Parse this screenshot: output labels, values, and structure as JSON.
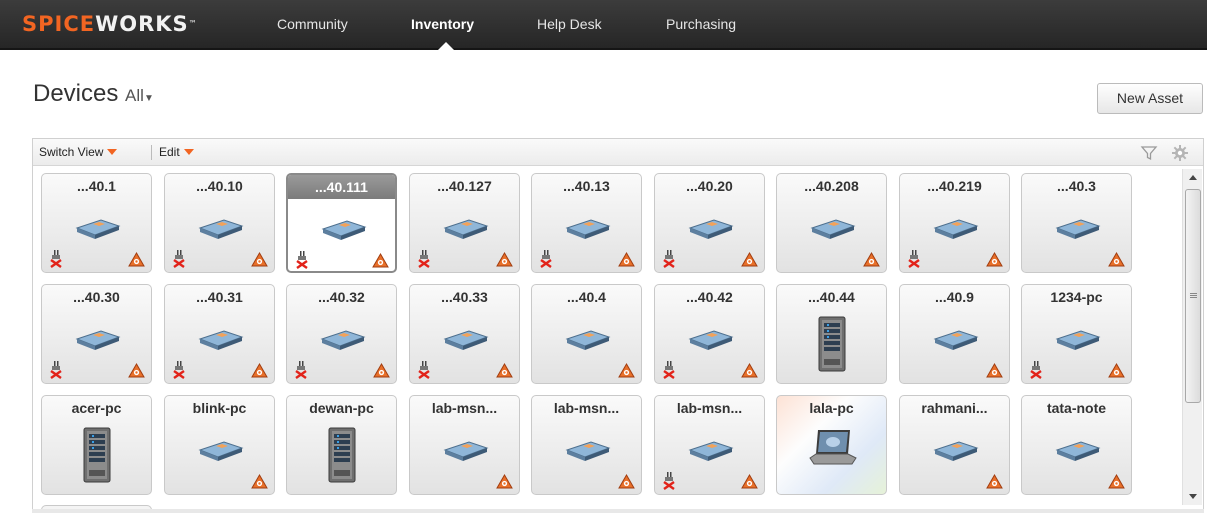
{
  "nav": {
    "logo": {
      "part1": "SPICE",
      "part2": "WORKS",
      "tm": "™"
    },
    "items": [
      "Community",
      "Inventory",
      "Help Desk",
      "Purchasing"
    ],
    "active": "Inventory"
  },
  "header": {
    "title": "Devices",
    "filter": "All",
    "new_asset_label": "New Asset"
  },
  "toolbar": {
    "switch_view_label": "Switch View",
    "edit_label": "Edit"
  },
  "colors": {
    "brand": "#f26522",
    "nav_bg": "#2f2f2f"
  },
  "devices": [
    {
      "name": "...40.1",
      "icon": "network-device-icon",
      "unplugged": true,
      "alert": true
    },
    {
      "name": "...40.10",
      "icon": "network-device-icon",
      "unplugged": true,
      "alert": true
    },
    {
      "name": "...40.111",
      "icon": "network-device-icon",
      "unplugged": true,
      "alert": true,
      "selected": true
    },
    {
      "name": "...40.127",
      "icon": "network-device-icon",
      "unplugged": true,
      "alert": true
    },
    {
      "name": "...40.13",
      "icon": "network-device-icon",
      "unplugged": true,
      "alert": true
    },
    {
      "name": "...40.20",
      "icon": "network-device-icon",
      "unplugged": true,
      "alert": true
    },
    {
      "name": "...40.208",
      "icon": "network-device-icon",
      "unplugged": false,
      "alert": true
    },
    {
      "name": "...40.219",
      "icon": "network-device-icon",
      "unplugged": true,
      "alert": true
    },
    {
      "name": "...40.3",
      "icon": "network-device-icon",
      "unplugged": false,
      "alert": true
    },
    {
      "name": "...40.30",
      "icon": "network-device-icon",
      "unplugged": true,
      "alert": true
    },
    {
      "name": "...40.31",
      "icon": "network-device-icon",
      "unplugged": true,
      "alert": true
    },
    {
      "name": "...40.32",
      "icon": "network-device-icon",
      "unplugged": true,
      "alert": true
    },
    {
      "name": "...40.33",
      "icon": "network-device-icon",
      "unplugged": true,
      "alert": true
    },
    {
      "name": "...40.4",
      "icon": "network-device-icon",
      "unplugged": false,
      "alert": true
    },
    {
      "name": "...40.42",
      "icon": "network-device-icon",
      "unplugged": true,
      "alert": true
    },
    {
      "name": "...40.44",
      "icon": "server-tower-icon",
      "unplugged": false,
      "alert": false
    },
    {
      "name": "...40.9",
      "icon": "network-device-icon",
      "unplugged": false,
      "alert": true
    },
    {
      "name": "1234-pc",
      "icon": "network-device-icon",
      "unplugged": true,
      "alert": true
    },
    {
      "name": "acer-pc",
      "icon": "server-tower-icon",
      "unplugged": false,
      "alert": false
    },
    {
      "name": "blink-pc",
      "icon": "network-device-icon",
      "unplugged": false,
      "alert": true
    },
    {
      "name": "dewan-pc",
      "icon": "server-tower-icon",
      "unplugged": false,
      "alert": false
    },
    {
      "name": "lab-msn...",
      "icon": "network-device-icon",
      "unplugged": false,
      "alert": true
    },
    {
      "name": "lab-msn...",
      "icon": "network-device-icon",
      "unplugged": false,
      "alert": true
    },
    {
      "name": "lab-msn...",
      "icon": "network-device-icon",
      "unplugged": true,
      "alert": true
    },
    {
      "name": "lala-pc",
      "icon": "laptop-icon",
      "unplugged": false,
      "alert": false,
      "windows_bg": true
    },
    {
      "name": "rahmani...",
      "icon": "network-device-icon",
      "unplugged": false,
      "alert": true
    },
    {
      "name": "tata-note",
      "icon": "network-device-icon",
      "unplugged": false,
      "alert": true
    }
  ]
}
